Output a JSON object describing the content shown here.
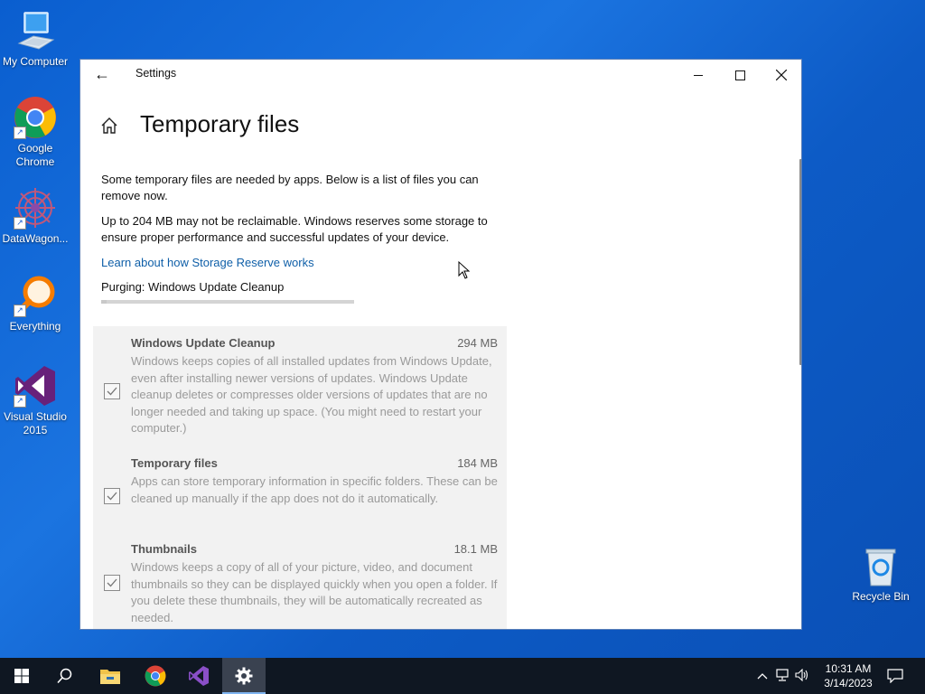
{
  "desktop": {
    "icons": [
      {
        "label": "My Computer"
      },
      {
        "label": "Google Chrome"
      },
      {
        "label": "DataWagon..."
      },
      {
        "label": "Everything"
      },
      {
        "label": "Visual Studio 2015"
      },
      {
        "label": "Recycle Bin"
      }
    ]
  },
  "window": {
    "title": "Settings",
    "back_icon": "arrow-left-icon",
    "controls": [
      "minimize",
      "maximize",
      "close"
    ]
  },
  "page": {
    "title": "Temporary files",
    "intro": "Some temporary files are needed by apps. Below is a list of files you can remove now.",
    "reserve_note": "Up to 204 MB may not be reclaimable. Windows reserves some storage to ensure proper performance and successful updates of your device.",
    "reserve_link": "Learn about how Storage Reserve works",
    "purging_status": "Purging: Windows Update Cleanup",
    "progress_fraction": 0.02
  },
  "items": [
    {
      "title": "Windows Update Cleanup",
      "size": "294 MB",
      "checked": true,
      "desc": "Windows keeps copies of all installed updates from Windows Update, even after installing newer versions of updates. Windows Update cleanup deletes or compresses older versions of updates that are no longer needed and taking up space. (You might need to restart your computer.)"
    },
    {
      "title": "Temporary files",
      "size": "184 MB",
      "checked": true,
      "desc": "Apps can store temporary information in specific folders. These can be cleaned up manually if the app does not do it automatically."
    },
    {
      "title": "Thumbnails",
      "size": "18.1 MB",
      "checked": true,
      "desc": "Windows keeps a copy of all of your picture, video, and document thumbnails so they can be displayed quickly when you open a folder. If you delete these thumbnails, they will be automatically recreated as needed."
    }
  ],
  "taskbar": {
    "apps": [
      "start-icon",
      "search-icon",
      "file-explorer-icon",
      "chrome-icon",
      "visual-studio-icon",
      "settings-icon"
    ],
    "time": "10:31 AM",
    "date": "3/14/2023"
  },
  "colors": {
    "accent": "#0f5fa8",
    "desktop": "#1b74e0",
    "taskbar": "#0f1722"
  }
}
